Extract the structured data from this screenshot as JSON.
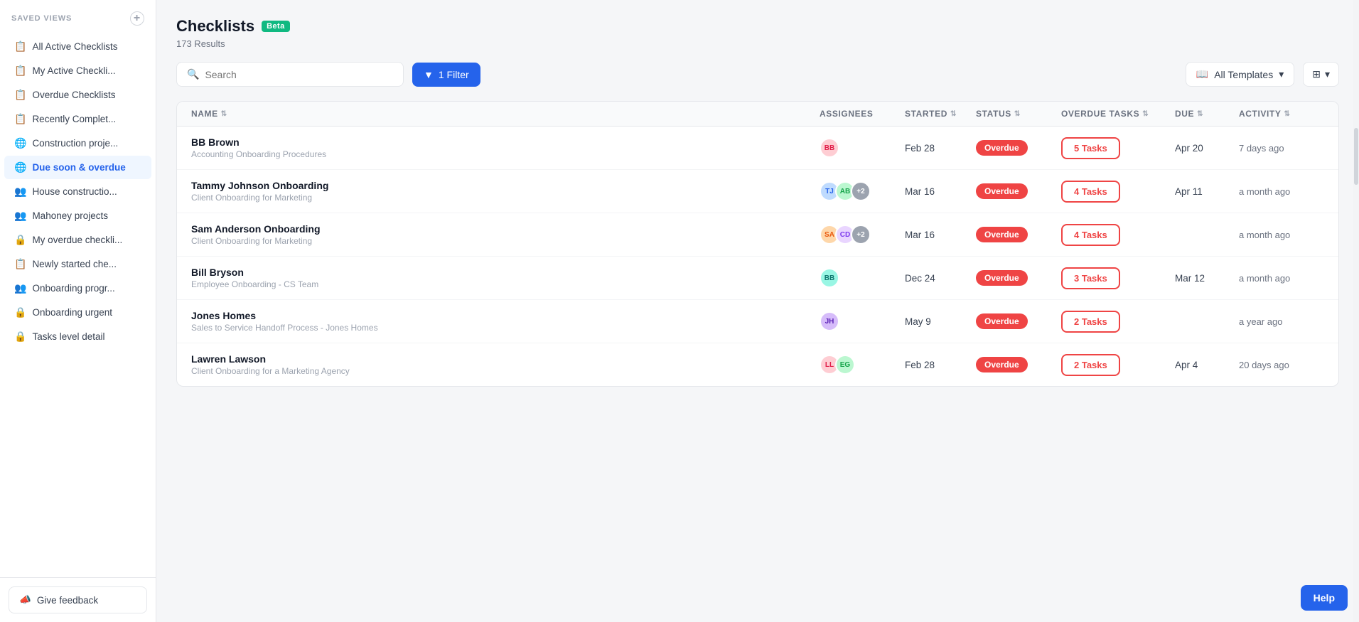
{
  "sidebar": {
    "header_label": "SAVED VIEWS",
    "items": [
      {
        "id": "all-active",
        "label": "All Active Checklists",
        "icon": "📋",
        "active": false
      },
      {
        "id": "my-active",
        "label": "My Active Checkli...",
        "icon": "📋",
        "active": false
      },
      {
        "id": "overdue",
        "label": "Overdue Checklists",
        "icon": "📋",
        "active": false
      },
      {
        "id": "recently",
        "label": "Recently Complet...",
        "icon": "📋",
        "active": false
      },
      {
        "id": "construction",
        "label": "Construction proje...",
        "icon": "🌐",
        "active": false
      },
      {
        "id": "due-soon",
        "label": "Due soon & overdue",
        "icon": "🌐",
        "active": true
      },
      {
        "id": "house",
        "label": "House constructio...",
        "icon": "👥",
        "active": false
      },
      {
        "id": "mahoney",
        "label": "Mahoney projects",
        "icon": "👥",
        "active": false
      },
      {
        "id": "my-overdue",
        "label": "My overdue checkli...",
        "icon": "🔒",
        "active": false
      },
      {
        "id": "newly",
        "label": "Newly started che...",
        "icon": "📋",
        "active": false
      },
      {
        "id": "onboarding-prog",
        "label": "Onboarding progr...",
        "icon": "👥",
        "active": false
      },
      {
        "id": "onboarding-urgent",
        "label": "Onboarding urgent",
        "icon": "🔒",
        "active": false
      },
      {
        "id": "tasks-level",
        "label": "Tasks level detail",
        "icon": "🔒",
        "active": false
      }
    ],
    "feedback_label": "Give feedback"
  },
  "page": {
    "title": "Checklists",
    "beta_label": "Beta",
    "results_count": "173 Results"
  },
  "toolbar": {
    "search_placeholder": "Search",
    "filter_label": "1 Filter",
    "templates_label": "All Templates",
    "view_icon": "⊞"
  },
  "table": {
    "columns": [
      {
        "id": "name",
        "label": "NAME",
        "sortable": true
      },
      {
        "id": "assignees",
        "label": "ASSIGNEES",
        "sortable": false
      },
      {
        "id": "started",
        "label": "STARTED",
        "sortable": true
      },
      {
        "id": "status",
        "label": "STATUS",
        "sortable": true
      },
      {
        "id": "overdue_tasks",
        "label": "OVERDUE TASKS",
        "sortable": true
      },
      {
        "id": "due",
        "label": "DUE",
        "sortable": true
      },
      {
        "id": "activity",
        "label": "ACTIVITY",
        "sortable": true
      }
    ],
    "rows": [
      {
        "id": "1",
        "name": "BB Brown",
        "subtitle": "Accounting Onboarding Procedures",
        "assignees": [
          {
            "initials": "BB",
            "color": "av-pink"
          }
        ],
        "started": "Feb 28",
        "status": "Overdue",
        "overdue_tasks": "5 Tasks",
        "due": "Apr 20",
        "activity": "7 days ago"
      },
      {
        "id": "2",
        "name": "Tammy Johnson Onboarding",
        "subtitle": "Client Onboarding for Marketing",
        "assignees": [
          {
            "initials": "TJ",
            "color": "av-blue"
          },
          {
            "initials": "AB",
            "color": "av-green"
          },
          {
            "initials": "+2",
            "color": "av-gray"
          }
        ],
        "started": "Mar 16",
        "status": "Overdue",
        "overdue_tasks": "4 Tasks",
        "due": "Apr 11",
        "activity": "a month ago"
      },
      {
        "id": "3",
        "name": "Sam Anderson Onboarding",
        "subtitle": "Client Onboarding for Marketing",
        "assignees": [
          {
            "initials": "SA",
            "color": "av-orange"
          },
          {
            "initials": "CD",
            "color": "av-purple"
          },
          {
            "initials": "+2",
            "color": "av-gray"
          }
        ],
        "started": "Mar 16",
        "status": "Overdue",
        "overdue_tasks": "4 Tasks",
        "due": "",
        "activity": "a month ago"
      },
      {
        "id": "4",
        "name": "Bill Bryson",
        "subtitle": "Employee Onboarding - CS Team",
        "assignees": [
          {
            "initials": "BB",
            "color": "av-teal"
          }
        ],
        "started": "Dec 24",
        "status": "Overdue",
        "overdue_tasks": "3 Tasks",
        "due": "Mar 12",
        "activity": "a month ago"
      },
      {
        "id": "5",
        "name": "Jones Homes",
        "subtitle": "Sales to Service Handoff Process - Jones Homes",
        "assignees": [
          {
            "initials": "JH",
            "color": "av-brown"
          }
        ],
        "started": "May 9",
        "status": "Overdue",
        "overdue_tasks": "2 Tasks",
        "due": "",
        "activity": "a year ago"
      },
      {
        "id": "6",
        "name": "Lawren Lawson",
        "subtitle": "Client Onboarding for a Marketing Agency",
        "assignees": [
          {
            "initials": "LL",
            "color": "av-pink"
          },
          {
            "initials": "EG",
            "color": "av-green"
          }
        ],
        "started": "Feb 28",
        "status": "Overdue",
        "overdue_tasks": "2 Tasks",
        "due": "Apr 4",
        "activity": "20 days ago"
      }
    ]
  },
  "help_label": "Help"
}
